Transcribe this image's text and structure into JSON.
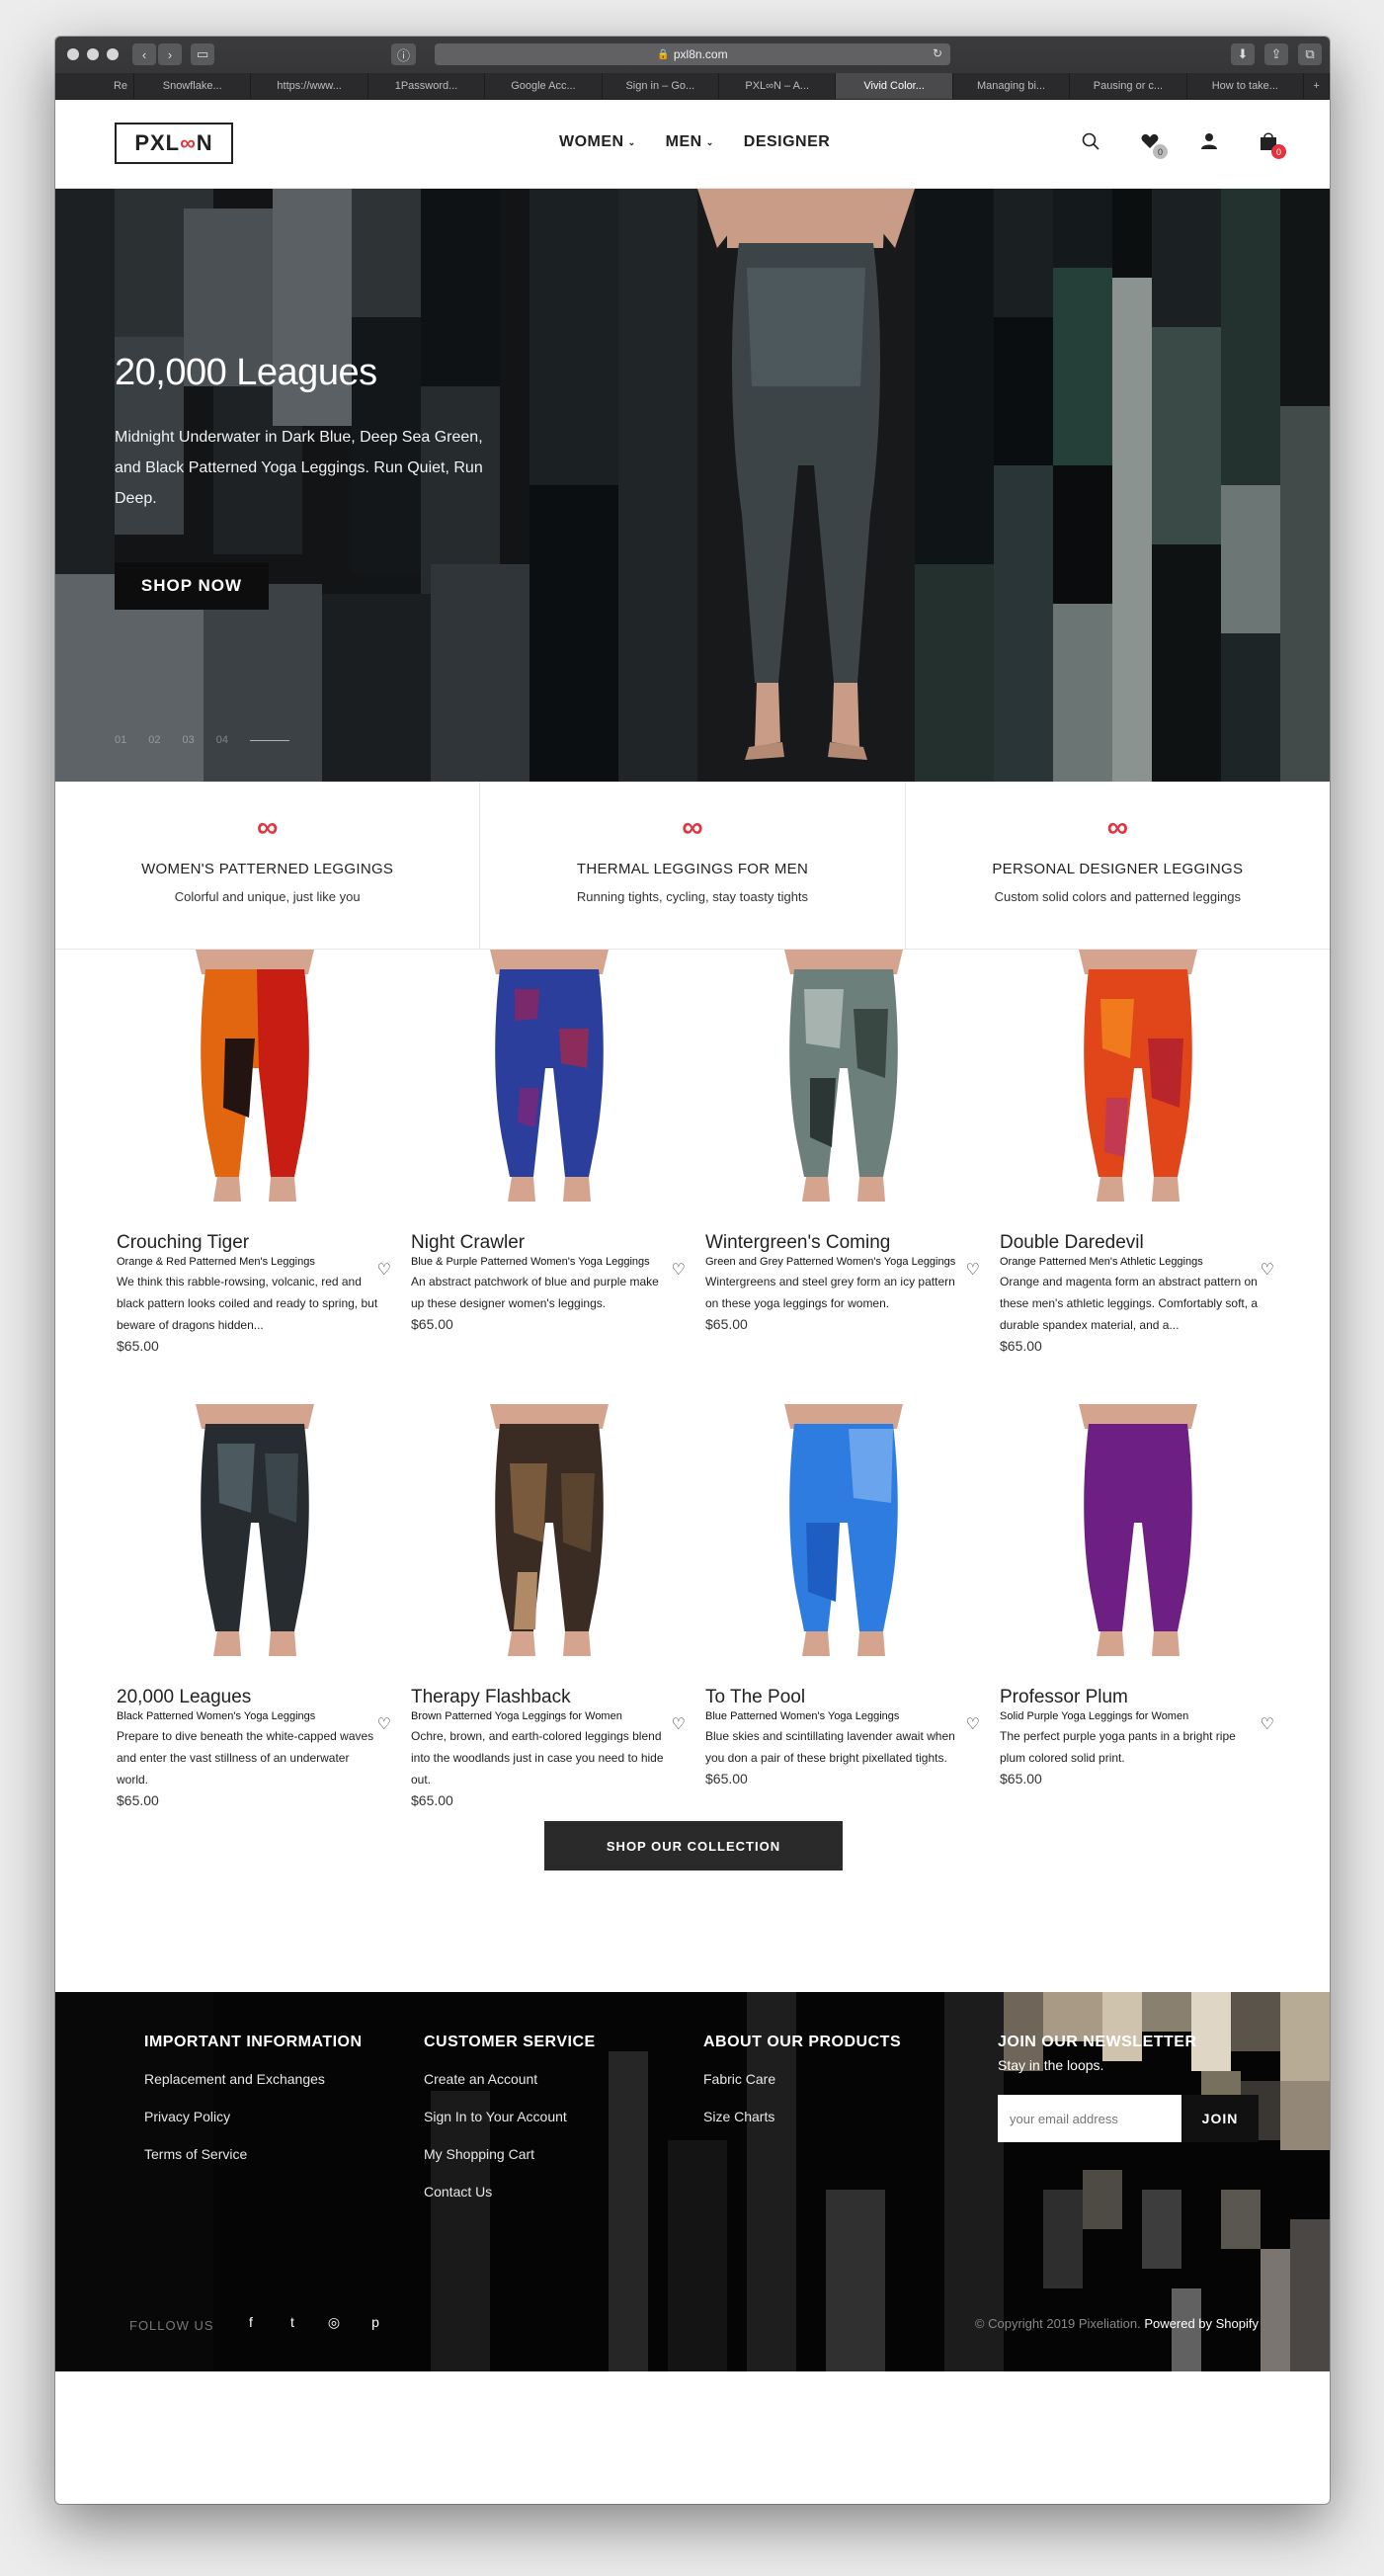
{
  "browser": {
    "url": "pxl8n.com",
    "tabs": [
      "Re",
      "Snowflake...",
      "https://www...",
      "1Password...",
      "Google Acc...",
      "Sign in – Go...",
      "PXL∞N – A...",
      "Vivid Color...",
      "Managing bi...",
      "Pausing or c...",
      "How to take..."
    ],
    "active_tab_index": 7
  },
  "header": {
    "logo_text": "PXL",
    "logo_loop": "∞",
    "logo_end": "N",
    "nav": [
      {
        "label": "WOMEN",
        "has_dropdown": true
      },
      {
        "label": "MEN",
        "has_dropdown": true
      },
      {
        "label": "DESIGNER",
        "has_dropdown": false
      }
    ],
    "wishlist_count": "0",
    "cart_count": "0"
  },
  "hero": {
    "title": "20,000 Leagues",
    "subtitle": "Midnight Underwater in Dark Blue, Deep Sea Green, and Black Patterned Yoga Leggings. Run Quiet, Run Deep.",
    "cta": "SHOP NOW",
    "slides": [
      "01",
      "02",
      "03",
      "04"
    ]
  },
  "features": [
    {
      "icon": "∞",
      "title": "WOMEN'S PATTERNED LEGGINGS",
      "subtitle": "Colorful and unique, just like you"
    },
    {
      "icon": "∞",
      "title": "THERMAL LEGGINGS FOR MEN",
      "subtitle": "Running tights, cycling, stay toasty tights"
    },
    {
      "icon": "∞",
      "title": "PERSONAL DESIGNER LEGGINGS",
      "subtitle": "Custom solid colors and patterned leggings"
    }
  ],
  "products": [
    {
      "name": "Crouching Tiger",
      "line": "Orange & Red Patterned Men's Leggings",
      "desc": "We think this rabble-rowsing, volcanic, red and black pattern looks coiled and ready to spring, but beware of dragons hidden...",
      "price": "$65.00"
    },
    {
      "name": "Night Crawler",
      "line": "Blue & Purple Patterned Women's Yoga Leggings",
      "desc": "An abstract patchwork of blue and purple make up these designer women's leggings.",
      "price": "$65.00"
    },
    {
      "name": "Wintergreen's Coming",
      "line": "Green and Grey Patterned Women's Yoga Leggings",
      "desc": "Wintergreens and steel grey form an icy pattern on these yoga leggings for women.",
      "price": "$65.00"
    },
    {
      "name": "Double Daredevil",
      "line": "Orange Patterned Men's Athletic Leggings",
      "desc": "Orange and magenta form an abstract pattern on these men's athletic leggings. Comfortably soft, a durable spandex material, and a...",
      "price": "$65.00"
    },
    {
      "name": "20,000 Leagues",
      "line": "Black Patterned Women's Yoga Leggings",
      "desc": "Prepare to dive beneath the white-capped waves and enter the vast stillness of an underwater world.",
      "price": "$65.00"
    },
    {
      "name": "Therapy Flashback",
      "line": "Brown Patterned Yoga Leggings for Women",
      "desc": "Ochre, brown, and earth-colored leggings blend into the woodlands just in case you need to hide out.",
      "price": "$65.00"
    },
    {
      "name": "To The Pool",
      "line": "Blue Patterned Women's Yoga Leggings",
      "desc": "Blue skies and scintillating lavender await when you don a pair of these bright pixellated tights.",
      "price": "$65.00"
    },
    {
      "name": "Professor Plum",
      "line": "Solid Purple Yoga Leggings for Women",
      "desc": "The perfect purple yoga pants in a bright ripe plum colored solid print.",
      "price": "$65.00"
    }
  ],
  "collection_cta": "SHOP OUR COLLECTION",
  "footer": {
    "important": {
      "title": "IMPORTANT INFORMATION",
      "links": [
        "Replacement and Exchanges",
        "Privacy Policy",
        "Terms of Service"
      ]
    },
    "service": {
      "title": "CUSTOMER SERVICE",
      "links": [
        "Create an Account",
        "Sign In to Your Account",
        "My Shopping Cart",
        "Contact Us"
      ]
    },
    "about": {
      "title": "ABOUT OUR PRODUCTS",
      "links": [
        "Fabric Care",
        "Size Charts"
      ]
    },
    "newsletter": {
      "title": "JOIN OUR NEWSLETTER",
      "subtitle": "Stay in the loops.",
      "placeholder": "your email address",
      "button": "JOIN"
    },
    "follow_label": "FOLLOW US",
    "social": [
      "f",
      "t",
      "◎",
      "p"
    ],
    "copyright": "© Copyright 2019 Pixeliation.",
    "powered": "Powered by Shopify"
  },
  "colors": {
    "accent": "#e2333e",
    "dark": "#0d0d0d"
  }
}
